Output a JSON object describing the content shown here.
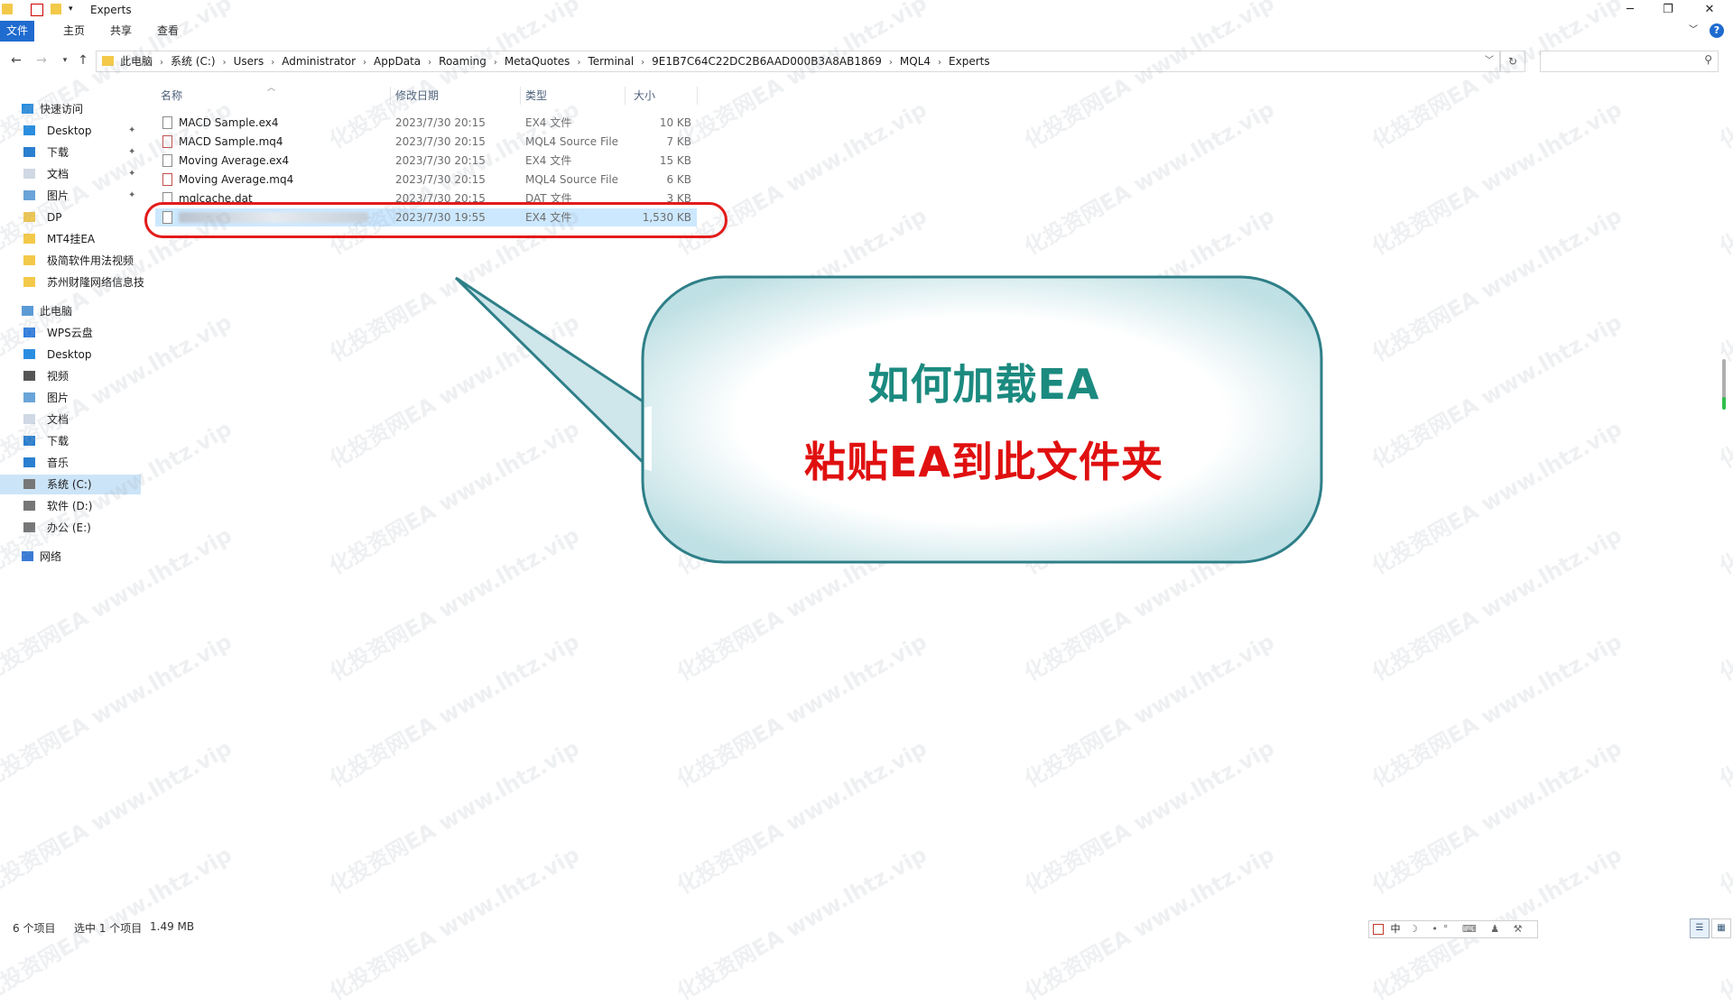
{
  "window": {
    "title": "Experts"
  },
  "ribbon": {
    "tabs": [
      "文件",
      "主页",
      "共享",
      "查看"
    ]
  },
  "address": {
    "crumbs": [
      "此电脑",
      "系统 (C:)",
      "Users",
      "Administrator",
      "AppData",
      "Roaming",
      "MetaQuotes",
      "Terminal",
      "9E1B7C64C22DC2B6AAD000B3A8AB1869",
      "MQL4",
      "Experts"
    ],
    "search_placeholder": ""
  },
  "sidebar": {
    "quick_access": "快速访问",
    "quick_items": [
      {
        "label": "Desktop",
        "pinned": true,
        "icon": "desktop-icon"
      },
      {
        "label": "下载",
        "pinned": true,
        "icon": "download-icon"
      },
      {
        "label": "文档",
        "pinned": true,
        "icon": "document-icon"
      },
      {
        "label": "图片",
        "pinned": true,
        "icon": "picture-icon"
      },
      {
        "label": "DP",
        "pinned": false,
        "icon": "folder-icon"
      },
      {
        "label": "MT4挂EA",
        "pinned": false,
        "icon": "folder-icon"
      },
      {
        "label": "极简软件用法视频",
        "pinned": false,
        "icon": "folder-icon"
      },
      {
        "label": "苏州财隆网络信息技",
        "pinned": false,
        "icon": "folder-icon"
      }
    ],
    "this_pc": "此电脑",
    "pc_items": [
      {
        "label": "WPS云盘",
        "icon": "cloud-icon"
      },
      {
        "label": "Desktop",
        "icon": "desktop-icon"
      },
      {
        "label": "视频",
        "icon": "video-icon"
      },
      {
        "label": "图片",
        "icon": "picture-icon"
      },
      {
        "label": "文档",
        "icon": "document-icon"
      },
      {
        "label": "下载",
        "icon": "download-icon"
      },
      {
        "label": "音乐",
        "icon": "music-icon"
      },
      {
        "label": "系统 (C:)",
        "icon": "drive-icon",
        "selected": true
      },
      {
        "label": "软件 (D:)",
        "icon": "drive-icon"
      },
      {
        "label": "办公 (E:)",
        "icon": "drive-icon"
      }
    ],
    "network": "网络"
  },
  "columns": {
    "name": "名称",
    "date": "修改日期",
    "type": "类型",
    "size": "大小"
  },
  "files": [
    {
      "name": "MACD Sample.ex4",
      "date": "2023/7/30 20:15",
      "type": "EX4 文件",
      "size": "10 KB",
      "kind": "ex4"
    },
    {
      "name": "MACD Sample.mq4",
      "date": "2023/7/30 20:15",
      "type": "MQL4 Source File",
      "size": "7 KB",
      "kind": "mq4"
    },
    {
      "name": "Moving Average.ex4",
      "date": "2023/7/30 20:15",
      "type": "EX4 文件",
      "size": "15 KB",
      "kind": "ex4"
    },
    {
      "name": "Moving Average.mq4",
      "date": "2023/7/30 20:15",
      "type": "MQL4 Source File",
      "size": "6 KB",
      "kind": "mq4"
    },
    {
      "name": "mqlcache.dat",
      "date": "2023/7/30 20:15",
      "type": "DAT 文件",
      "size": "3 KB",
      "kind": "dat"
    },
    {
      "name": "",
      "date": "2023/7/30 19:55",
      "type": "EX4 文件",
      "size": "1,530 KB",
      "kind": "ex4",
      "selected": true,
      "blurred": true
    }
  ],
  "callout": {
    "line1": "如何加载EA",
    "line2": "粘贴EA到此文件夹",
    "line1_color": "#1b8a7f",
    "line2_color": "#e01010"
  },
  "watermark": {
    "text1": "化投资网EA",
    "text2": "www.lhtz.vip"
  },
  "status": {
    "count": "6 个项目",
    "selected": "选中 1 个项目",
    "size": "1.49 MB"
  },
  "ime": "中"
}
